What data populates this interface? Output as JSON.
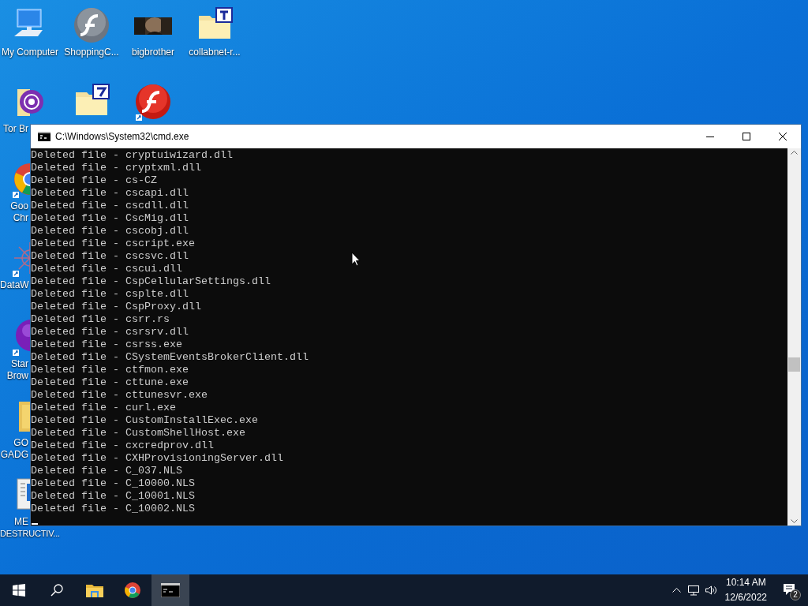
{
  "desktop_icons": [
    {
      "kind": "computer",
      "label_lines": [
        "My Computer"
      ]
    },
    {
      "kind": "flash-gray",
      "label_lines": [
        "ShoppingC..."
      ]
    },
    {
      "kind": "picture",
      "label_lines": [
        "bigbrother"
      ]
    },
    {
      "kind": "folder-t",
      "label_lines": [
        "collabnet-r..."
      ]
    },
    {
      "kind": "tor-folder",
      "label_lines": [
        "Tor Br"
      ]
    },
    {
      "kind": "folder-7"
    },
    {
      "kind": "flash-red"
    },
    {
      "kind": "chrome",
      "label_lines": [
        "Goo",
        "Chr"
      ]
    },
    {
      "kind": "molecule",
      "label_lines": [
        "DataW"
      ]
    },
    {
      "kind": "orb",
      "label_lines": [
        "Star",
        "Brow"
      ]
    },
    {
      "kind": "folder",
      "label_lines": [
        "GO",
        "GADG"
      ]
    },
    {
      "kind": "document",
      "label_lines": [
        "ME",
        "DESTRUCTIV..."
      ]
    }
  ],
  "window": {
    "title": "C:\\Windows\\System32\\cmd.exe",
    "lines": [
      "Deleted file - cryptuiwizard.dll",
      "Deleted file - cryptxml.dll",
      "Deleted file - cs-CZ",
      "Deleted file - cscapi.dll",
      "Deleted file - cscdll.dll",
      "Deleted file - CscMig.dll",
      "Deleted file - cscobj.dll",
      "Deleted file - cscript.exe",
      "Deleted file - cscsvc.dll",
      "Deleted file - cscui.dll",
      "Deleted file - CspCellularSettings.dll",
      "Deleted file - csplte.dll",
      "Deleted file - CspProxy.dll",
      "Deleted file - csrr.rs",
      "Deleted file - csrsrv.dll",
      "Deleted file - csrss.exe",
      "Deleted file - CSystemEventsBrokerClient.dll",
      "Deleted file - ctfmon.exe",
      "Deleted file - cttune.exe",
      "Deleted file - cttunesvr.exe",
      "Deleted file - curl.exe",
      "Deleted file - CustomInstallExec.exe",
      "Deleted file - CustomShellHost.exe",
      "Deleted file - cxcredprov.dll",
      "Deleted file - CXHProvisioningServer.dll",
      "Deleted file - C_037.NLS",
      "Deleted file - C_10000.NLS",
      "Deleted file - C_10001.NLS",
      "Deleted file - C_10002.NLS"
    ]
  },
  "taskbar": {
    "items": [
      {
        "kind": "start",
        "selected": false
      },
      {
        "kind": "search",
        "selected": false
      },
      {
        "kind": "explorer",
        "selected": false
      },
      {
        "kind": "chrome",
        "selected": false
      },
      {
        "kind": "cmd",
        "selected": true
      }
    ],
    "time": "10:14 AM",
    "date": "12/6/2022",
    "notification_count": "2"
  }
}
